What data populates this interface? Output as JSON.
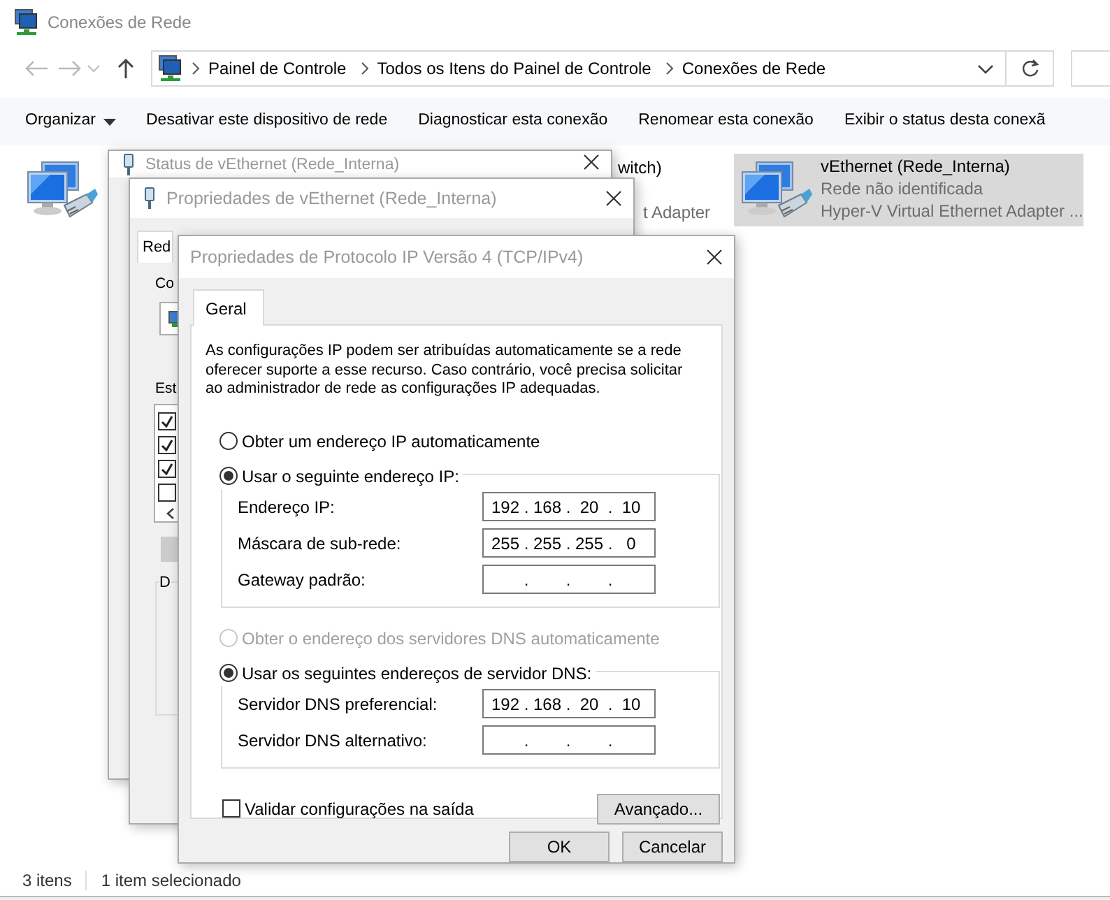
{
  "explorer": {
    "title": "Conexões de Rede",
    "breadcrumb": [
      "Painel de Controle",
      "Todos os Itens do Painel de Controle",
      "Conexões de Rede"
    ],
    "commands": [
      {
        "label": "Organizar",
        "kind": "menu"
      },
      {
        "label": "Desativar este dispositivo de rede",
        "kind": "action"
      },
      {
        "label": "Diagnosticar esta conexão",
        "kind": "action"
      },
      {
        "label": "Renomear esta conexão",
        "kind": "action"
      },
      {
        "label": "Exibir o status desta conexã",
        "kind": "action"
      }
    ],
    "connections": [
      {
        "kind": "icon-only",
        "selected": false
      },
      {
        "kind": "fragment",
        "name": "witch)",
        "adapter": "t Adapter",
        "selected": false
      },
      {
        "kind": "full",
        "name": "vEthernet (Rede_Interna)",
        "status": "Rede não identificada",
        "adapter": "Hyper-V Virtual Ethernet Adapter ...",
        "selected": true
      }
    ],
    "status_bar": [
      "3 itens",
      "1 item selecionado"
    ]
  },
  "status_window": {
    "title": "Status de vEthernet (Rede_Interna)"
  },
  "properties_window": {
    "title": "Propriedades de vEthernet (Rede_Interna)",
    "tab": {
      "label": "Red",
      "selected": true
    },
    "labels": [
      "Co",
      "Est"
    ],
    "group_label": "D",
    "components": [
      {
        "checked": true
      },
      {
        "checked": true
      },
      {
        "checked": true
      },
      {
        "checked": false
      }
    ]
  },
  "ipv4_dialog": {
    "title": "Propriedades de Protocolo IP Versão 4 (TCP/IPv4)",
    "tabs": [
      {
        "label": "Geral",
        "selected": true
      }
    ],
    "description": "As configurações IP podem ser atribuídas automaticamente se a rede oferecer suporte a esse recurso. Caso contrário, você precisa solicitar ao administrador de rede as configurações IP adequadas.",
    "ip_section": {
      "auto": {
        "label": "Obter um endereço IP automaticamente",
        "selected": false,
        "disabled": false
      },
      "manual": {
        "label": "Usar o seguinte endereço IP:",
        "selected": true,
        "disabled": false
      },
      "fields": [
        {
          "label": "Endereço IP:",
          "octets": [
            "192",
            "168",
            "20",
            "10"
          ],
          "dots": [
            ".",
            ".",
            "."
          ]
        },
        {
          "label": "Máscara de sub-rede:",
          "octets": [
            "255",
            "255",
            "255",
            "0"
          ],
          "dots": [
            ".",
            ".",
            "."
          ]
        },
        {
          "label": "Gateway padrão:",
          "dots": [
            ".",
            ".",
            "."
          ]
        }
      ]
    },
    "dns_section": {
      "auto": {
        "label": "Obter o endereço dos servidores DNS automaticamente",
        "selected": false,
        "disabled": true
      },
      "manual": {
        "label": "Usar os seguintes endereços de servidor DNS:",
        "selected": true,
        "disabled": false
      },
      "fields": [
        {
          "label": "Servidor DNS preferencial:",
          "octets": [
            "192",
            "168",
            "20",
            "10"
          ],
          "dots": [
            ".",
            ".",
            "."
          ]
        },
        {
          "label": "Servidor DNS alternativo:",
          "dots": [
            ".",
            ".",
            "."
          ]
        }
      ]
    },
    "validate": {
      "label": "Validar configurações na saída",
      "checked": false
    },
    "advanced_button": "Avançado...",
    "buttons": [
      "OK",
      "Cancelar"
    ]
  }
}
